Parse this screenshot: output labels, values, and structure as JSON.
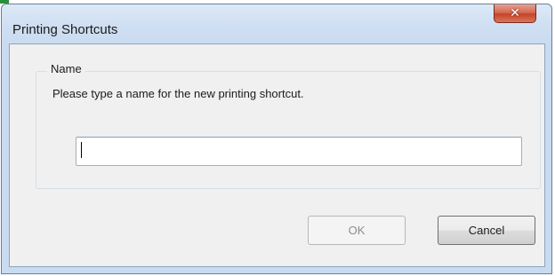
{
  "window": {
    "title": "Printing Shortcuts",
    "close_icon": "close-icon"
  },
  "group": {
    "label": "Name",
    "instruction": "Please type a name for the new printing shortcut."
  },
  "name_field": {
    "value": "",
    "placeholder": ""
  },
  "buttons": {
    "ok_label": "OK",
    "ok_enabled": false,
    "cancel_label": "Cancel"
  },
  "colors": {
    "titlebar": "#cfdff2",
    "close_button": "#c6442b",
    "dialog_background": "#f0f0f0"
  }
}
